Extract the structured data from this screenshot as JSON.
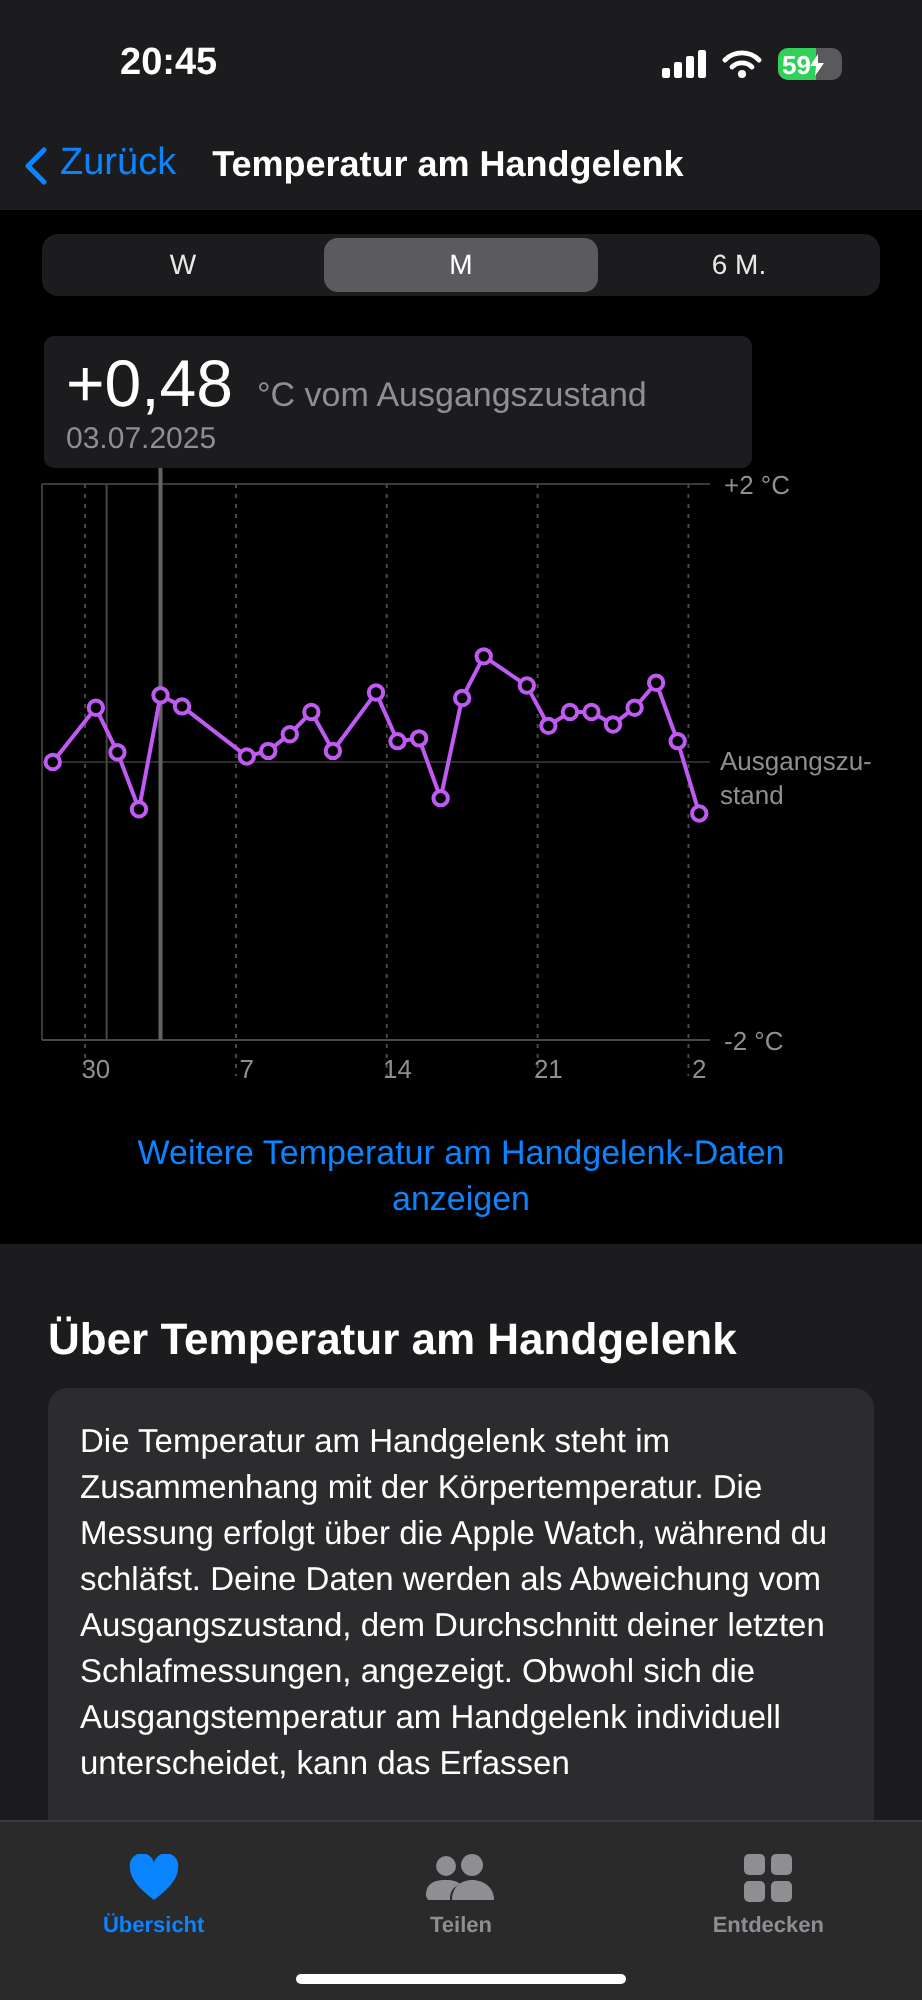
{
  "status_bar": {
    "time": "20:45",
    "battery": "59"
  },
  "nav": {
    "back": "Zurück",
    "title": "Temperatur am Handgelenk"
  },
  "segments": [
    {
      "label": "W",
      "selected": false
    },
    {
      "label": "M",
      "selected": true
    },
    {
      "label": "6 M.",
      "selected": false
    }
  ],
  "readout": {
    "value": "+0,48",
    "unit": "°C vom Ausgangszustand",
    "date": "03.07.2025"
  },
  "chart": {
    "baseline_label": "Ausgangszu-stand",
    "chart_data": {
      "type": "line",
      "xlim": [
        "2025-06-28",
        "2025-07-29"
      ],
      "ylim": [
        -2,
        2
      ],
      "xticks": [
        {
          "value": "2025-06-30T12:00",
          "label": "30"
        },
        {
          "value": "2025-07-07T12:00",
          "label": "7"
        },
        {
          "value": "2025-07-14T12:00",
          "label": "14"
        },
        {
          "value": "2025-07-21T12:00",
          "label": "21"
        },
        {
          "value": "2025-07-28T12:00",
          "label": "2"
        }
      ],
      "yticks": [
        {
          "value": 2,
          "label": "+2 °C"
        },
        {
          "value": -2,
          "label": "-2 °C"
        }
      ],
      "series": [
        {
          "color": "#bf5af2",
          "marker": "o",
          "x": [
            "2025-06-28T12:00",
            "2025-06-30T12:00",
            "2025-07-01T12:00",
            "2025-07-02T12:00",
            "2025-07-03T12:00",
            "2025-07-04T12:00",
            "2025-07-07T12:00",
            "2025-07-08T12:00",
            "2025-07-09T12:00",
            "2025-07-10T12:00",
            "2025-07-11T12:00",
            "2025-07-13T12:00",
            "2025-07-14T12:00",
            "2025-07-15T12:00",
            "2025-07-16T12:00",
            "2025-07-17T12:00",
            "2025-07-18T12:00",
            "2025-07-20T12:00",
            "2025-07-21T12:00",
            "2025-07-22T12:00",
            "2025-07-23T12:00",
            "2025-07-24T12:00",
            "2025-07-25T12:00",
            "2025-07-26T12:00",
            "2025-07-27T12:00",
            "2025-07-28T12:00"
          ],
          "values": [
            0,
            0.39,
            0.07,
            -0.34,
            0.48,
            0.4,
            0.04,
            0.08,
            0.2,
            0.36,
            0.08,
            0.5,
            0.15,
            0.17,
            -0.26,
            0.46,
            0.76,
            0.55,
            0.26,
            0.36,
            0.36,
            0.27,
            0.39,
            0.57,
            0.15,
            -0.37
          ]
        }
      ],
      "ref_lines": [
        {
          "axis": "x",
          "value": "2025-07-01",
          "color": "#48484a"
        },
        {
          "axis": "x",
          "value": "2025-07-03T12:00",
          "color": "#636366"
        }
      ]
    }
  },
  "more_link": "Weitere Temperatur am Handgelenk-Daten anzeigen",
  "about": {
    "heading": "Über Temperatur am Handgelenk",
    "body": "Die Temperatur am Handgelenk steht im Zusammenhang mit der Körpertemperatur. Die Messung erfolgt über die Apple Watch, während du schläfst. Deine Daten werden als Abweichung vom Ausgangszustand, dem Durchschnitt deiner letzten Schlafmessungen, angezeigt. Obwohl sich die Ausgangstemperatur am Handgelenk individuell unterscheidet, kann das Erfassen"
  },
  "tab_bar": [
    {
      "label": "Übersicht",
      "selected": true
    },
    {
      "label": "Teilen",
      "selected": false
    },
    {
      "label": "Entdecken",
      "selected": false
    }
  ]
}
